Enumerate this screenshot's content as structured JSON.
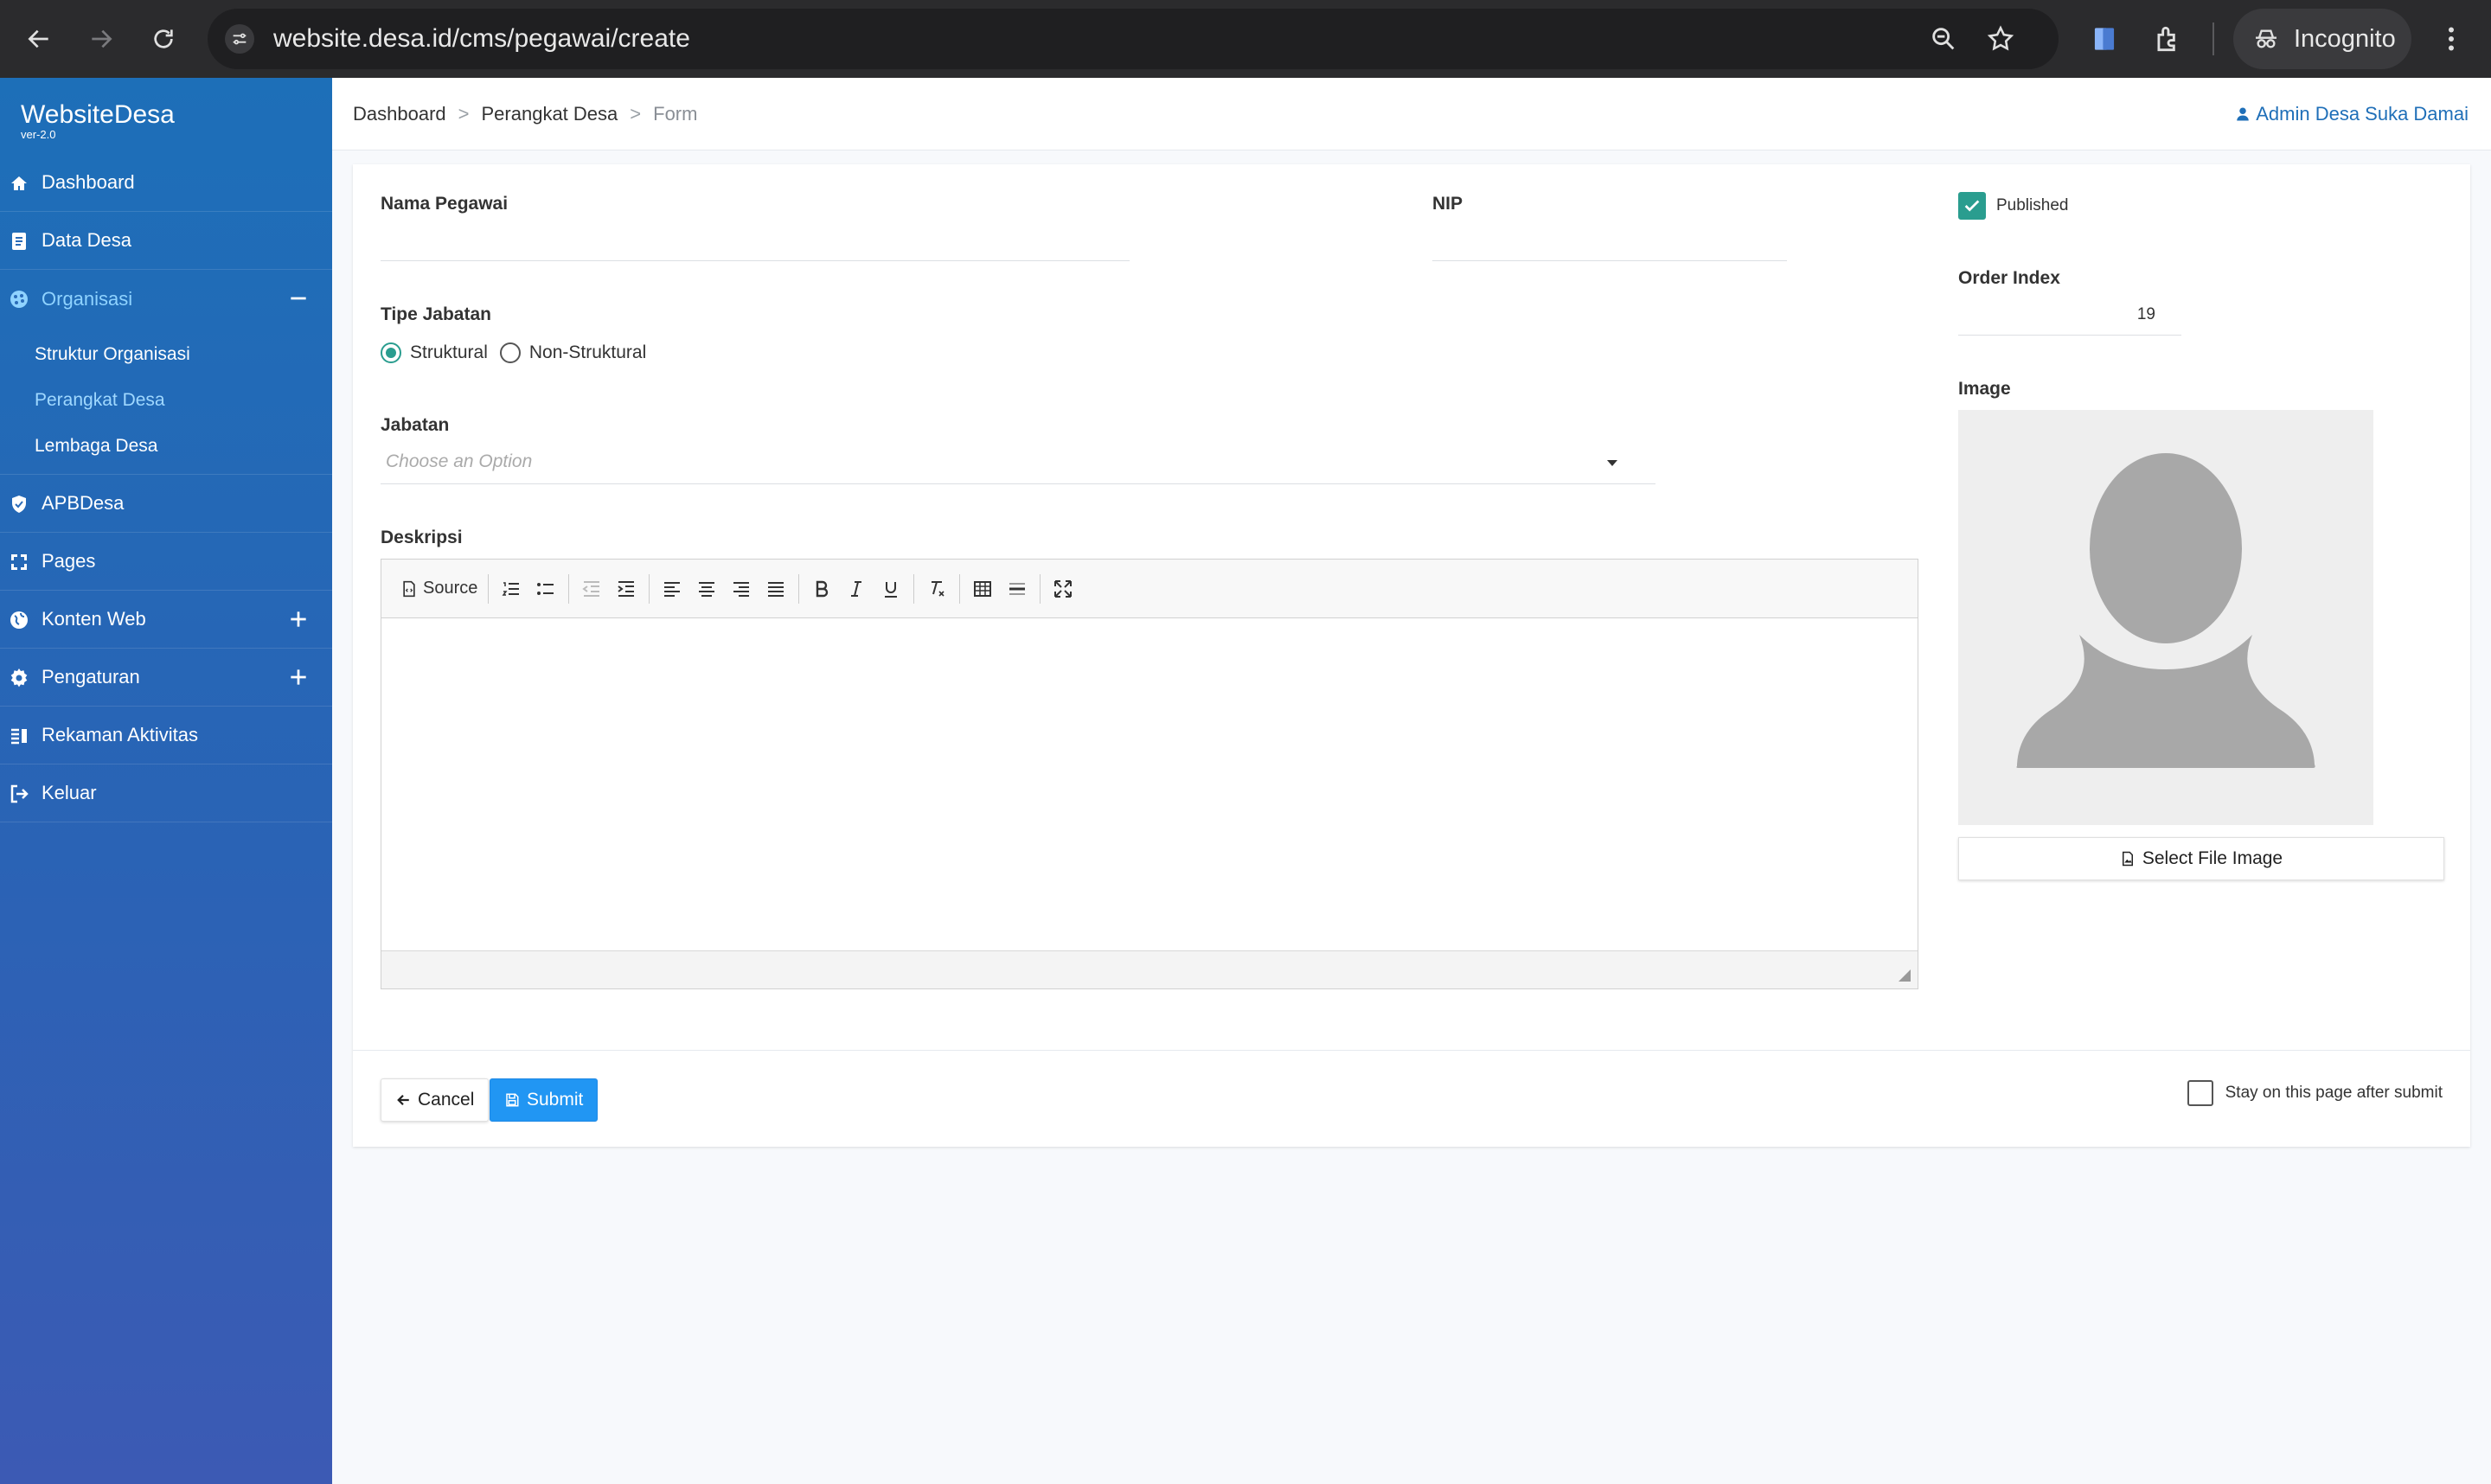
{
  "browser": {
    "url": "website.desa.id/cms/pegawai/create",
    "incognito_label": "Incognito"
  },
  "sidebar": {
    "brand": "WebsiteDesa",
    "version": "ver-2.0",
    "items": [
      {
        "label": "Dashboard",
        "icon": "home-icon"
      },
      {
        "label": "Data Desa",
        "icon": "document-icon"
      },
      {
        "label": "Organisasi",
        "icon": "palette-icon",
        "expanded": true,
        "children": [
          {
            "label": "Struktur Organisasi"
          },
          {
            "label": "Perangkat Desa",
            "current": true
          },
          {
            "label": "Lembaga Desa"
          }
        ]
      },
      {
        "label": "APBDesa",
        "icon": "shield-icon"
      },
      {
        "label": "Pages",
        "icon": "pages-icon"
      },
      {
        "label": "Konten Web",
        "icon": "globe-icon",
        "expandable": true
      },
      {
        "label": "Pengaturan",
        "icon": "gear-icon",
        "expandable": true
      },
      {
        "label": "Rekaman Aktivitas",
        "icon": "list-icon"
      },
      {
        "label": "Keluar",
        "icon": "logout-icon"
      }
    ]
  },
  "topbar": {
    "breadcrumb": [
      "Dashboard",
      "Perangkat Desa",
      "Form"
    ],
    "breadcrumb_separator": ">",
    "user": "Admin Desa Suka Damai"
  },
  "form": {
    "nama_label": "Nama Pegawai",
    "nama_value": "",
    "nip_label": "NIP",
    "nip_value": "",
    "tipe_label": "Tipe Jabatan",
    "tipe_options": [
      "Struktural",
      "Non-Struktural"
    ],
    "tipe_selected": "Struktural",
    "jabatan_label": "Jabatan",
    "jabatan_placeholder": "Choose an Option",
    "deskripsi_label": "Deskripsi",
    "editor_source_label": "Source",
    "published_label": "Published",
    "published_checked": true,
    "order_label": "Order Index",
    "order_value": "19",
    "image_label": "Image",
    "select_image_label": "Select File Image",
    "cancel_label": "Cancel",
    "submit_label": "Submit",
    "stay_label": "Stay on this page after submit",
    "stay_checked": false
  },
  "colors": {
    "sidebar_top": "#1d6fb8",
    "sidebar_bottom": "#3c5ab4",
    "accent_teal": "#2a9d8f",
    "submit_blue": "#2196f3",
    "link_blue": "#1f6fb8"
  }
}
